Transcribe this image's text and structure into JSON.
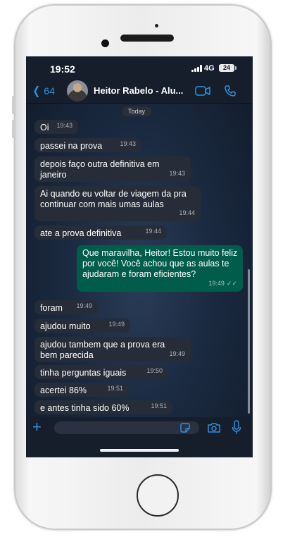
{
  "status_bar": {
    "time": "19:52",
    "network": "4G",
    "battery": "24"
  },
  "header": {
    "back_label": "64",
    "contact_name": "Heitor Rabelo - Alu..."
  },
  "date_label": "Today",
  "messages": [
    {
      "text": "Oi",
      "time": "19:43",
      "dir": "in"
    },
    {
      "text": "passei na prova",
      "time": "19:43",
      "dir": "in"
    },
    {
      "text": "depois faço outra definitiva em janeiro",
      "time": "19:43",
      "dir": "in"
    },
    {
      "text": "Ai quando eu voltar de viagem da pra continuar com mais umas aulas",
      "time": "19:44",
      "dir": "in"
    },
    {
      "text": "ate a prova definitiva",
      "time": "19:44",
      "dir": "in"
    },
    {
      "text": "Que maravilha, Heitor! Estou muito feliz por você! Você achou que as aulas te ajudaram e foram eficientes?",
      "time": "19:49",
      "dir": "out"
    },
    {
      "text": "foram",
      "time": "19:49",
      "dir": "in"
    },
    {
      "text": "ajudou muito",
      "time": "19:49",
      "dir": "in"
    },
    {
      "text": "ajudou tambem que a prova era bem parecida",
      "time": "19:49",
      "dir": "in"
    },
    {
      "text": "tinha perguntas iguais",
      "time": "19:50",
      "dir": "in"
    },
    {
      "text": "acertei 86%",
      "time": "19:51",
      "dir": "in"
    },
    {
      "text": "e antes tinha sido 60%",
      "time": "19:51",
      "dir": "in"
    }
  ],
  "icons": {
    "back": "chevron-left-icon",
    "video": "video-call-icon",
    "call": "phone-icon",
    "plus": "plus-icon",
    "sticker": "sticker-icon",
    "camera": "camera-icon",
    "mic": "microphone-icon",
    "read_receipt": "double-check-icon"
  },
  "colors": {
    "accent": "#2f8fe0",
    "incoming_bubble": "#262d38",
    "outgoing_bubble": "#005c4b"
  }
}
